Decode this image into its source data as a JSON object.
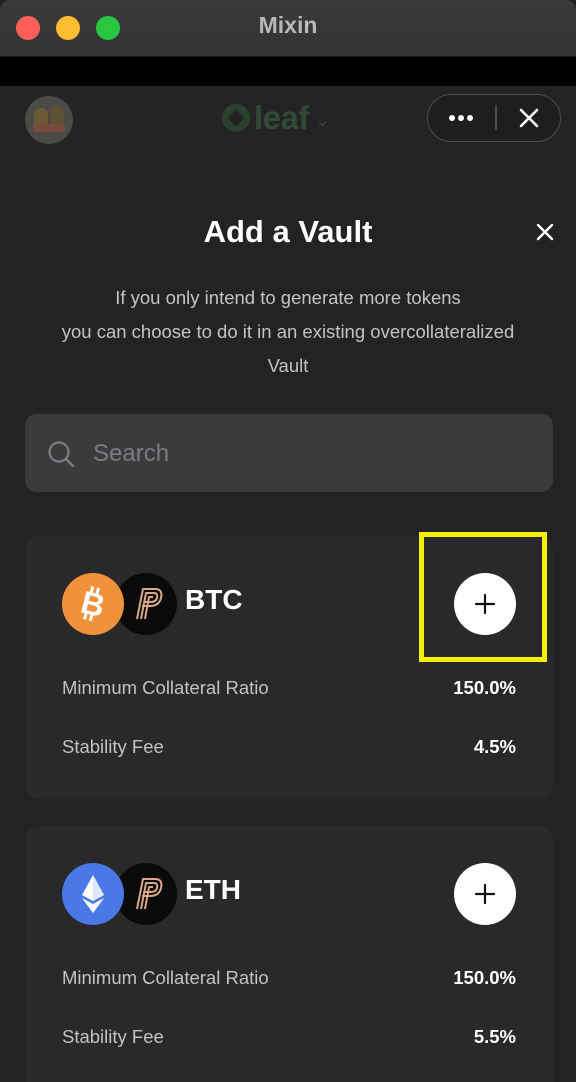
{
  "window": {
    "title": "Mixin"
  },
  "app_header": {
    "brand_name": "leaf"
  },
  "modal": {
    "title": "Add a Vault",
    "subtitle_lines": [
      "If you only intend to generate more tokens",
      "you can choose to do it in an existing overcollateralized",
      "Vault"
    ]
  },
  "search": {
    "placeholder": "Search",
    "value": ""
  },
  "vaults": [
    {
      "token": "BTC",
      "asset_icon": "bitcoin-icon",
      "asset_color": "#f0923a",
      "min_ratio_label": "Minimum Collateral Ratio",
      "min_ratio_value": "150.0%",
      "fee_label": "Stability Fee",
      "fee_value": "4.5%"
    },
    {
      "token": "ETH",
      "asset_icon": "ethereum-icon",
      "asset_color": "#4a78e6",
      "min_ratio_label": "Minimum Collateral Ratio",
      "min_ratio_value": "150.0%",
      "fee_label": "Stability Fee",
      "fee_value": "5.5%"
    }
  ],
  "highlight_color": "#f5f000"
}
